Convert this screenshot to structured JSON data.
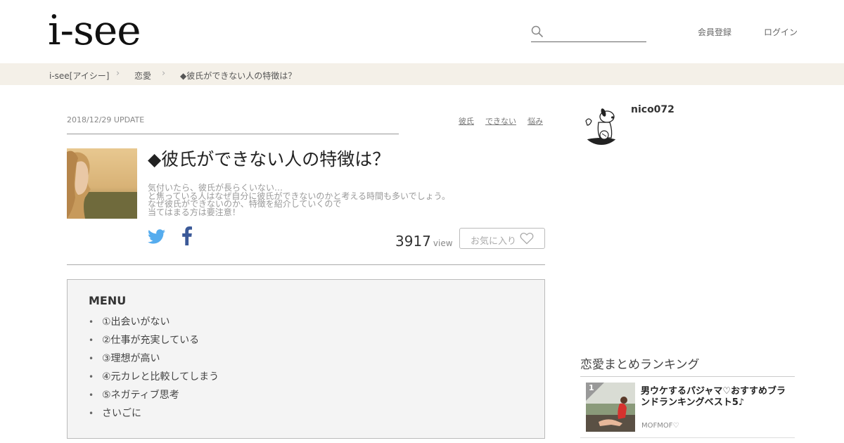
{
  "header": {
    "logo": "i-see",
    "search_placeholder": "",
    "register_label": "会員登録",
    "login_label": "ログイン"
  },
  "breadcrumb": [
    "i-see[アイシー]",
    "恋愛",
    "◆彼氏ができない人の特徴は？"
  ],
  "article": {
    "date": "2018/12/29 UPDATE",
    "tags": [
      "彼氏",
      "できない",
      "悩み"
    ],
    "title": "◆彼氏ができない人の特徴は？",
    "description_lines": [
      "気付いたら、彼氏が長らくいない…",
      "と焦っている人はなぜ自分に彼氏ができないのかと考える時間も多いでしょう。",
      "なぜ彼氏ができないのか、特徴を紹介していくので",
      "当てはまる方は要注意！"
    ],
    "view_count": "3917",
    "view_unit": "view",
    "favorite_label": "お気に入り"
  },
  "menu": {
    "title": "MENU",
    "items": [
      "①出会いがない",
      "②仕事が充実している",
      "③理想が高い",
      "④元カレと比較してしまう",
      "⑤ネガティブ思考",
      "さいごに"
    ]
  },
  "sidebar": {
    "author": "nico072",
    "ranking_heading": "恋愛まとめランキング",
    "ranking": [
      {
        "rank": "1",
        "title": "男ウケするパジャマ♡おすすめブランドランキングベスト5♪",
        "author": "MOFMOF♡"
      }
    ]
  },
  "colors": {
    "breadcrumb_bg": "#f4f0e8",
    "twitter": "#55acee",
    "facebook": "#3b5998",
    "menu_bg": "#f4f4f4"
  }
}
